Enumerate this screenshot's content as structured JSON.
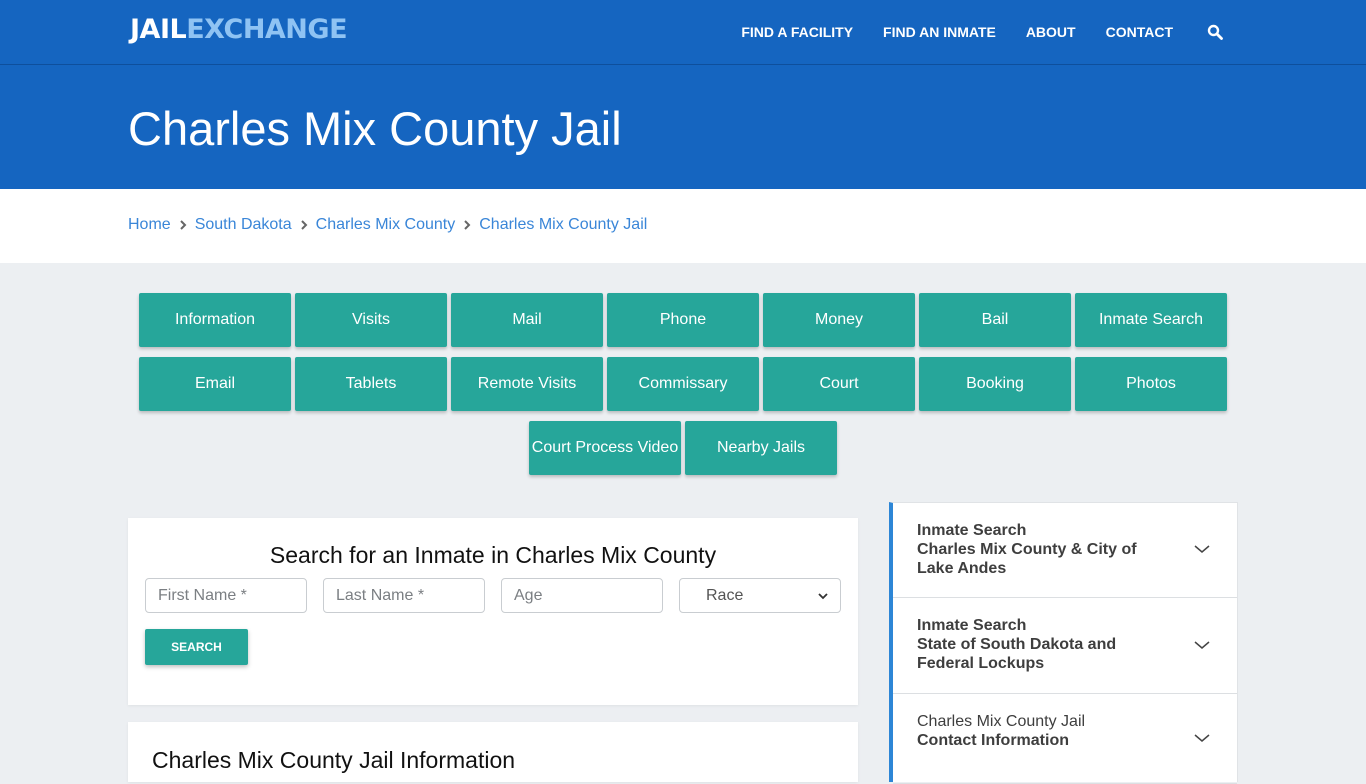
{
  "header": {
    "logo_part1": "JAIL",
    "logo_part2": "EXCHANGE",
    "nav": [
      {
        "label": "FIND A FACILITY"
      },
      {
        "label": "FIND AN INMATE"
      },
      {
        "label": "ABOUT"
      },
      {
        "label": "CONTACT"
      }
    ],
    "search_icon": "search-icon"
  },
  "hero": {
    "title": "Charles Mix County Jail"
  },
  "breadcrumb": [
    {
      "label": "Home"
    },
    {
      "label": "South Dakota"
    },
    {
      "label": "Charles Mix County"
    },
    {
      "label": "Charles Mix County Jail"
    }
  ],
  "tiles": [
    {
      "label": "Information"
    },
    {
      "label": "Visits"
    },
    {
      "label": "Mail"
    },
    {
      "label": "Phone"
    },
    {
      "label": "Money"
    },
    {
      "label": "Bail"
    },
    {
      "label": "Inmate Search"
    },
    {
      "label": "Email"
    },
    {
      "label": "Tablets"
    },
    {
      "label": "Remote Visits"
    },
    {
      "label": "Commissary"
    },
    {
      "label": "Court"
    },
    {
      "label": "Booking"
    },
    {
      "label": "Photos"
    },
    {
      "label": "Court Process Video"
    },
    {
      "label": "Nearby Jails"
    }
  ],
  "search": {
    "title": "Search for an Inmate in Charles Mix County",
    "first_name_placeholder": "First Name *",
    "last_name_placeholder": "Last Name *",
    "age_placeholder": "Age",
    "race_selected": "Race",
    "button_label": "SEARCH"
  },
  "info": {
    "title": "Charles Mix County Jail Information"
  },
  "sidebar": {
    "items": [
      {
        "line1": "Inmate Search",
        "line2": "Charles Mix County & City of Lake Andes"
      },
      {
        "line1": "Inmate Search",
        "line2": "State of South Dakota and Federal Lockups"
      },
      {
        "line1": "Charles Mix County Jail",
        "line2": "Contact Information"
      }
    ]
  },
  "colors": {
    "brand_blue": "#1565c0",
    "logo_accent": "#8fc3f3",
    "tile_teal": "#26a69a",
    "link_blue": "#3a86d8",
    "sidebar_accent": "#2d86d6"
  }
}
